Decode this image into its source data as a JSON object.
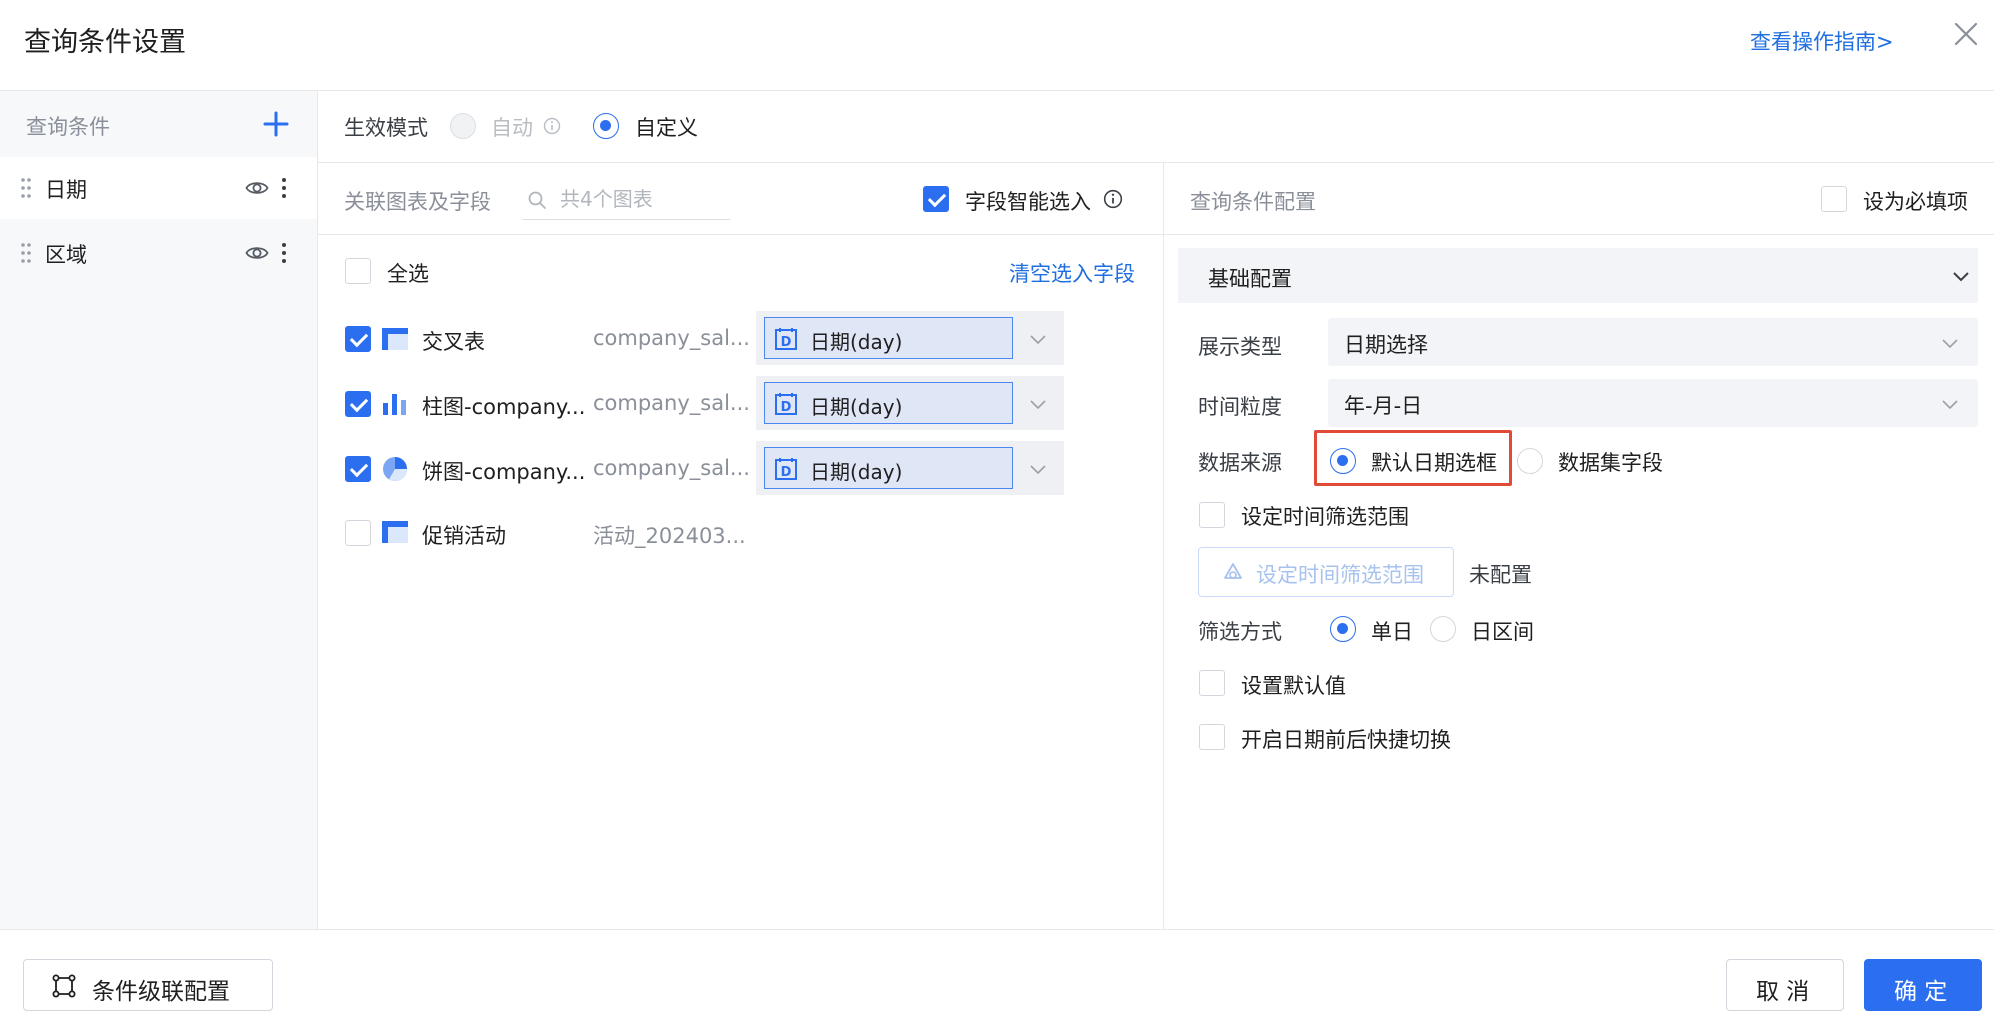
{
  "dialog": {
    "title": "查询条件设置",
    "guide_link": "查看操作指南>"
  },
  "conditions": {
    "header": "查询条件",
    "items": [
      {
        "label": "日期",
        "active": true
      },
      {
        "label": "区域",
        "active": false
      }
    ]
  },
  "mode": {
    "label": "生效模式",
    "options": [
      {
        "label": "自动",
        "selected": false,
        "disabled": true
      },
      {
        "label": "自定义",
        "selected": true,
        "disabled": false
      }
    ]
  },
  "charts": {
    "header": "关联图表及字段",
    "search_placeholder": "共4个图表",
    "smart_select_label": "字段智能选入",
    "smart_select_checked": true,
    "select_all_label": "全选",
    "clear_link": "清空选入字段",
    "rows": [
      {
        "name": "交叉表",
        "icon": "table-icon",
        "dataset": "company_sal...",
        "checked": true,
        "field": "日期(day)"
      },
      {
        "name": "柱图-company...",
        "icon": "bar-chart-icon",
        "dataset": "company_sal...",
        "checked": true,
        "field": "日期(day)"
      },
      {
        "name": "饼图-company...",
        "icon": "pie-chart-icon",
        "dataset": "company_sal...",
        "checked": true,
        "field": "日期(day)"
      },
      {
        "name": "促销活动",
        "icon": "table-icon",
        "dataset": "活动_202403...",
        "checked": false,
        "field": ""
      }
    ]
  },
  "config": {
    "header": "查询条件配置",
    "required_label": "设为必填项",
    "required_checked": false,
    "section_title": "基础配置",
    "display_type": {
      "label": "展示类型",
      "value": "日期选择"
    },
    "granularity": {
      "label": "时间粒度",
      "value": "年-月-日"
    },
    "data_source": {
      "label": "数据来源",
      "options": [
        {
          "label": "默认日期选框",
          "selected": true
        },
        {
          "label": "数据集字段",
          "selected": false
        }
      ]
    },
    "time_range_checkbox": "设定时间筛选范围",
    "time_range_button": "设定时间筛选范围",
    "time_range_status": "未配置",
    "filter_mode": {
      "label": "筛选方式",
      "options": [
        {
          "label": "单日",
          "selected": true
        },
        {
          "label": "日区间",
          "selected": false
        }
      ]
    },
    "default_value_label": "设置默认值",
    "quick_switch_label": "开启日期前后快捷切换"
  },
  "footer": {
    "cascade_button": "条件级联配置",
    "cancel_button": "取 消",
    "confirm_button": "确 定"
  },
  "colors": {
    "primary": "#2b6ff0",
    "link": "#1f6fe0",
    "highlight_box": "#e04a37"
  }
}
